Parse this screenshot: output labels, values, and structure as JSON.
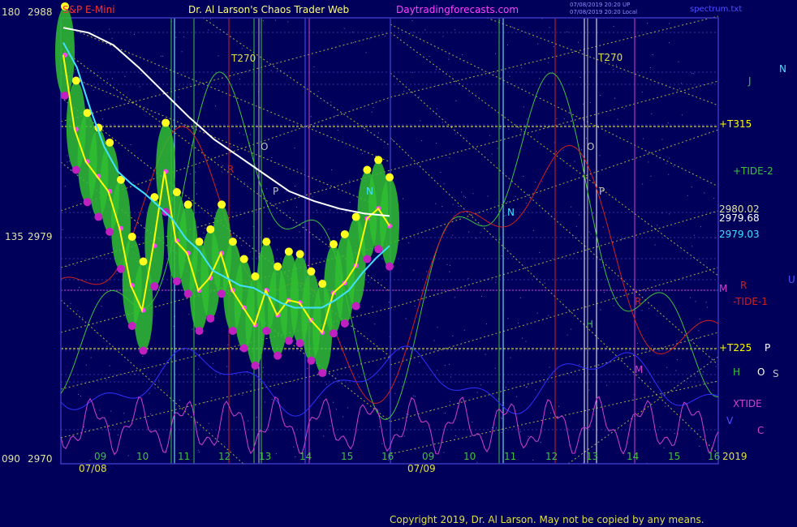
{
  "header": {
    "symbol": "S&P E-Mini",
    "title": "Dr. Al Larson's Chaos Trader Web",
    "site": "Daytradingforecasts.com",
    "stamp1": "07/08/2019 20:20 UP",
    "stamp2": "07/08/2019 20:20 Local",
    "file": "spectrum.txt"
  },
  "colors": {
    "background": "#00005a",
    "grid": "#3030a0",
    "price": "#ffff00",
    "cyan_ma": "#40e0ff",
    "white_ma": "#ffffff",
    "green": "#40c040",
    "red": "#d02020",
    "magenta": "#d040d0",
    "gold": "#e0e040"
  },
  "yaxis": {
    "left_labels": [
      {
        "deg": "180",
        "price": "2988"
      },
      {
        "deg": "135",
        "price": "2979"
      },
      {
        "deg": "090",
        "price": "2970"
      }
    ]
  },
  "xaxis": {
    "hours_day1": [
      "09",
      "10",
      "11",
      "12",
      "13",
      "14",
      "15",
      "16"
    ],
    "hours_day2": [
      "09",
      "10",
      "11",
      "12",
      "13",
      "14",
      "15",
      "16"
    ],
    "date1": "07/08",
    "date2": "07/09",
    "year": "2019"
  },
  "right_labels": {
    "n": "N",
    "j": "J",
    "tide2": "+TIDE-2",
    "p1": "2980.02",
    "p2": "2979.68",
    "p3": "2979.03",
    "m": "M",
    "r": "R",
    "tide1": "-TIDE-1",
    "u": "U",
    "p": "P",
    "h": "H",
    "o": "O",
    "s": "S",
    "xtide": "XTIDE",
    "v": "V",
    "c": "C",
    "t315": "+T315",
    "t225": "+T225"
  },
  "annotations": {
    "t270a": "T270",
    "t270b": "T270",
    "o1": "O",
    "o2": "O",
    "p1": "P",
    "p2": "P",
    "n1": "N",
    "n2": "N",
    "r1": "R",
    "r2": "R",
    "m1": "M",
    "h1": "H"
  },
  "copyright": "Copyright 2019, Dr. Al Larson. May not be copied by any means.",
  "chart_data": {
    "type": "line",
    "ylim": [
      2970,
      2988
    ],
    "series": [
      {
        "name": "price",
        "values": [
          2986.5,
          2983.5,
          2982.2,
          2981.6,
          2981.0,
          2979.5,
          2977.2,
          2976.2,
          2978.8,
          2981.8,
          2979.0,
          2978.5,
          2977.0,
          2977.5,
          2978.5,
          2977.0,
          2976.3,
          2975.6,
          2977.0,
          2976.0,
          2976.6,
          2976.5,
          2975.8,
          2975.3,
          2976.9,
          2977.3,
          2978.0,
          2979.9,
          2980.3,
          2979.6
        ]
      },
      {
        "name": "cyan",
        "values": [
          2987.0,
          2986.0,
          2984.3,
          2982.8,
          2981.8,
          2981.3,
          2980.9,
          2980.4,
          2979.9,
          2979.1,
          2978.6,
          2977.8,
          2977.5,
          2977.2,
          2977.1,
          2976.8,
          2976.5,
          2976.3,
          2976.3,
          2976.3,
          2976.6,
          2977.0,
          2977.7,
          2978.3,
          2978.8
        ]
      },
      {
        "name": "white",
        "values": [
          2987.6,
          2987.4,
          2986.9,
          2986.0,
          2985.0,
          2984.0,
          2983.1,
          2982.4,
          2981.7,
          2981.0,
          2980.6,
          2980.3,
          2980.1,
          2980.0
        ]
      }
    ]
  }
}
